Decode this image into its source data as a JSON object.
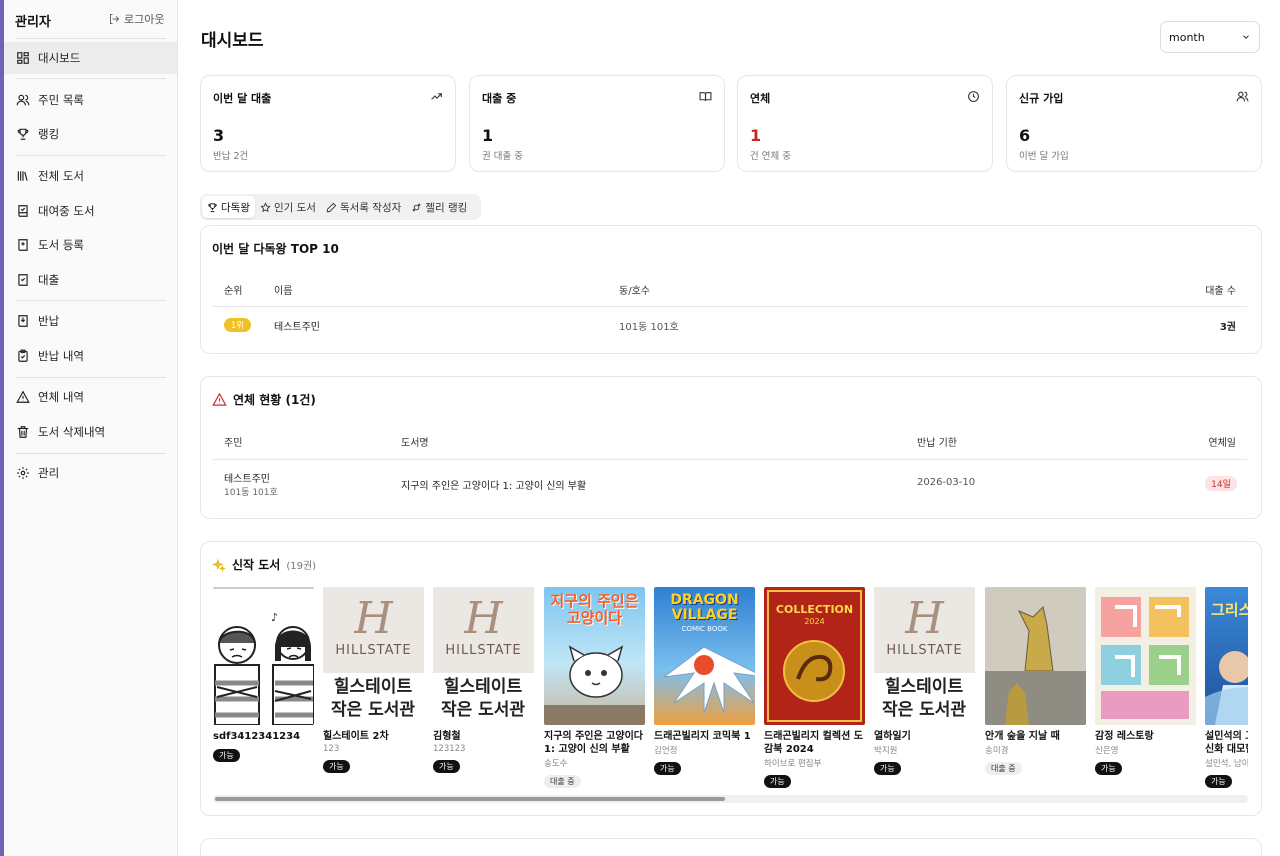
{
  "sidebar": {
    "title": "관리자",
    "logout": "로그아웃",
    "items": [
      {
        "label": "대시보드"
      },
      {
        "label": "주민 목록"
      },
      {
        "label": "랭킹"
      },
      {
        "label": "전체 도서"
      },
      {
        "label": "대여중 도서"
      },
      {
        "label": "도서 등록"
      },
      {
        "label": "대출"
      },
      {
        "label": "반납"
      },
      {
        "label": "반납 내역"
      },
      {
        "label": "연체 내역"
      },
      {
        "label": "도서 삭제내역"
      },
      {
        "label": "관리"
      }
    ]
  },
  "header": {
    "title": "대시보드",
    "period": "month"
  },
  "stats": [
    {
      "label": "이번 달 대출",
      "value": "3",
      "sub": "반납 2건",
      "icon": "trending-up-icon"
    },
    {
      "label": "대출 중",
      "value": "1",
      "sub": "권 대출 중",
      "icon": "book-open-icon"
    },
    {
      "label": "연체",
      "value": "1",
      "sub": "건 연체 중",
      "icon": "clock-icon",
      "color": "#c62828"
    },
    {
      "label": "신규 가입",
      "value": "6",
      "sub": "이번 달 가입",
      "icon": "users-icon"
    }
  ],
  "tabs": [
    {
      "label": "다독왕"
    },
    {
      "label": "인기 도서"
    },
    {
      "label": "독서록 작성자"
    },
    {
      "label": "젤리 랭킹"
    }
  ],
  "top_readers": {
    "title": "이번 달 다독왕 TOP 10",
    "columns": [
      "순위",
      "이름",
      "동/호수",
      "대출 수"
    ],
    "rows": [
      {
        "rank": "1위",
        "name": "테스트주민",
        "unit": "101동 101호",
        "count": "3권"
      }
    ]
  },
  "overdue": {
    "title": "연체 현황 (1건)",
    "columns": [
      "주민",
      "도서명",
      "반납 기한",
      "연체일"
    ],
    "rows": [
      {
        "name": "테스트주민",
        "unit": "101동 101호",
        "book": "지구의 주인은 고양이다 1: 고양이 신의 부활",
        "due": "2026-03-10",
        "days": "14일"
      }
    ]
  },
  "new_books": {
    "title": "신작 도서",
    "count": "(19권)",
    "items": [
      {
        "title": "sdf3412341234",
        "author": "",
        "status": "가능"
      },
      {
        "title": "힐스테이트 2차",
        "author": "123",
        "status": "가능"
      },
      {
        "title": "김형철",
        "author": "123123",
        "status": "가능"
      },
      {
        "title": "지구의 주인은 고양이다 1: 고양이 신의 부활",
        "author": "송도수",
        "status": "대출 중"
      },
      {
        "title": "드래곤빌리지 코믹북 1",
        "author": "김언정",
        "status": "가능"
      },
      {
        "title": "드래곤빌리지 컬렉션 도감북 2024",
        "author": "하이브로 편집부",
        "status": "가능"
      },
      {
        "title": "열하일기",
        "author": "박지원",
        "status": "가능"
      },
      {
        "title": "안개 숲을 지날 때",
        "author": "송미경",
        "status": "대출 중"
      },
      {
        "title": "감정 레스토랑",
        "author": "신은영",
        "status": "가능"
      },
      {
        "title": "설민석의 그리스 로마 신화 대모험",
        "author": "설민석, 남이",
        "status": "가능"
      }
    ],
    "covers": {
      "hillstate_letter": "H",
      "hillstate_name": "HILLSTATE",
      "hillstate_banner1": "힐스테이트",
      "hillstate_banner2": "작은 도서관",
      "cat_cover": "지구의 주인은 고양이다",
      "dragon_logo": "DRAGON VILLAGE",
      "dragon_sub": "COMIC BOOK",
      "collection_logo": "COLLECTION",
      "collection_year": "2024",
      "greek_cover": "그리스"
    }
  }
}
